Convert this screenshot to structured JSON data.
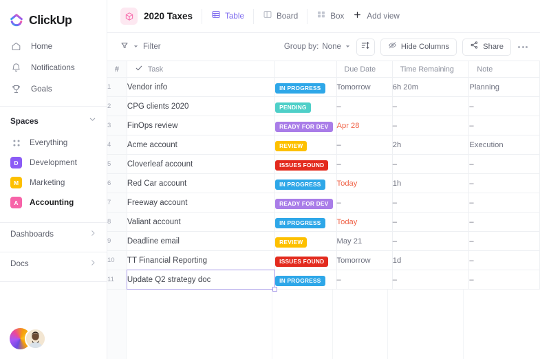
{
  "brand": {
    "name": "ClickUp",
    "accent": "#7b68ee"
  },
  "sidebar": {
    "nav": [
      {
        "label": "Home",
        "icon": "home-icon"
      },
      {
        "label": "Notifications",
        "icon": "bell-icon"
      },
      {
        "label": "Goals",
        "icon": "trophy-icon"
      }
    ],
    "spaces_title": "Spaces",
    "spaces": [
      {
        "label": "Everything",
        "icon": "dots-grid-icon",
        "initial": "",
        "color": "",
        "active": false
      },
      {
        "label": "Development",
        "icon": "space-badge",
        "initial": "D",
        "color": "#8b5cf6",
        "active": false
      },
      {
        "label": "Marketing",
        "icon": "space-badge",
        "initial": "M",
        "color": "#fdc000",
        "active": false
      },
      {
        "label": "Accounting",
        "icon": "space-badge",
        "initial": "A",
        "color": "#f763a8",
        "active": true
      }
    ],
    "footer": [
      {
        "label": "Dashboards"
      },
      {
        "label": "Docs"
      }
    ]
  },
  "header": {
    "title": "2020 Taxes",
    "tabs": [
      {
        "label": "Table",
        "icon": "table-icon",
        "active": true
      },
      {
        "label": "Board",
        "icon": "board-icon",
        "active": false
      },
      {
        "label": "Box",
        "icon": "box-icon",
        "active": false
      }
    ],
    "add_view": "Add view"
  },
  "toolbar": {
    "filter_label": "Filter",
    "group_by_label": "Group by:",
    "group_by_value": "None",
    "hide_columns_label": "Hide Columns",
    "share_label": "Share"
  },
  "table": {
    "columns": {
      "num": "#",
      "task": "Task",
      "status": "",
      "due": "Due Date",
      "time": "Time Remaining",
      "note": "Note"
    },
    "status_colors": {
      "IN PROGRESS": "#2ea7e8",
      "PENDING": "#4ecfc8",
      "READY FOR DEV": "#a97de8",
      "REVIEW": "#fdc000",
      "ISSUES FOUND": "#e32b1e"
    },
    "rows": [
      {
        "num": "1",
        "task": "Vendor info",
        "status": "IN PROGRESS",
        "due": "Tomorrow",
        "due_warn": false,
        "time": "6h 20m",
        "note": "Planning",
        "selected": false
      },
      {
        "num": "2",
        "task": "CPG clients 2020",
        "status": "PENDING",
        "due": "–",
        "due_warn": false,
        "time": "–",
        "note": "–",
        "selected": false
      },
      {
        "num": "3",
        "task": "FinOps review",
        "status": "READY FOR DEV",
        "due": "Apr 28",
        "due_warn": true,
        "time": "–",
        "note": "–",
        "selected": false
      },
      {
        "num": "4",
        "task": "Acme account",
        "status": "REVIEW",
        "due": "–",
        "due_warn": false,
        "time": "2h",
        "note": "Execution",
        "selected": false
      },
      {
        "num": "5",
        "task": "Cloverleaf account",
        "status": "ISSUES FOUND",
        "due": "–",
        "due_warn": false,
        "time": "–",
        "note": "–",
        "selected": false
      },
      {
        "num": "6",
        "task": "Red Car account",
        "status": "IN PROGRESS",
        "due": "Today",
        "due_warn": true,
        "time": "1h",
        "note": "–",
        "selected": false
      },
      {
        "num": "7",
        "task": "Freeway account",
        "status": "READY FOR DEV",
        "due": "–",
        "due_warn": false,
        "time": "–",
        "note": "–",
        "selected": false
      },
      {
        "num": "8",
        "task": "Valiant account",
        "status": "IN PROGRESS",
        "due": "Today",
        "due_warn": true,
        "time": "–",
        "note": "–",
        "selected": false
      },
      {
        "num": "9",
        "task": "Deadline email",
        "status": "REVIEW",
        "due": "May 21",
        "due_warn": false,
        "time": "–",
        "note": "–",
        "selected": false
      },
      {
        "num": "10",
        "task": "TT Financial Reporting",
        "status": "ISSUES FOUND",
        "due": "Tomorrow",
        "due_warn": false,
        "time": "1d",
        "note": "–",
        "selected": false
      },
      {
        "num": "11",
        "task": "Update Q2 strategy doc",
        "status": "IN PROGRESS",
        "due": "–",
        "due_warn": false,
        "time": "–",
        "note": "–",
        "selected": true
      }
    ]
  }
}
